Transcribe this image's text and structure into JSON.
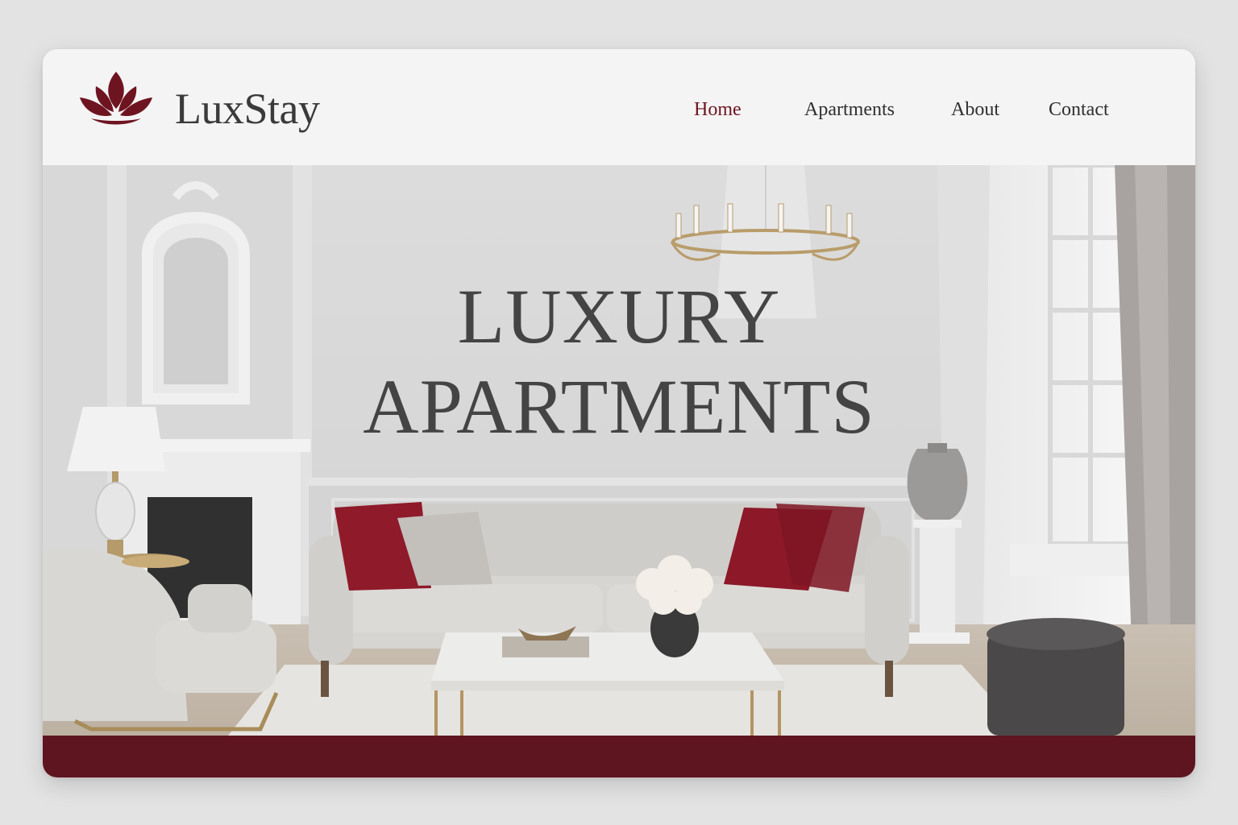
{
  "brand": {
    "name": "LuxStay",
    "logo_icon": "lotus-icon"
  },
  "nav": {
    "items": [
      {
        "label": "Home",
        "active": true
      },
      {
        "label": "Apartments",
        "active": false
      },
      {
        "label": "About",
        "active": false
      },
      {
        "label": "Contact",
        "active": false
      }
    ]
  },
  "hero": {
    "title_line1": "LUXURY",
    "title_line2": "APARTMENTS",
    "image": "luxury living room interior"
  },
  "colors": {
    "accent": "#6e1420",
    "footer": "#5e1520",
    "text": "#3a3a3a",
    "background": "#e3e3e4"
  }
}
